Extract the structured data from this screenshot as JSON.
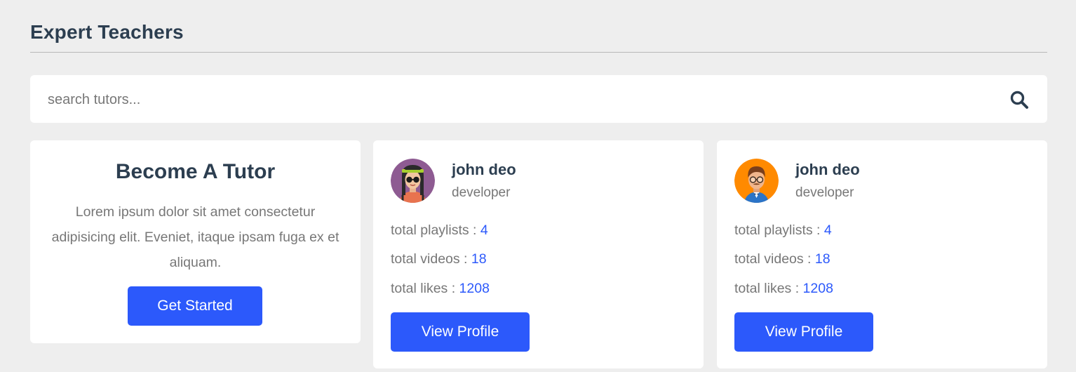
{
  "section": {
    "title": "Expert Teachers"
  },
  "search": {
    "placeholder": "search tutors..."
  },
  "become_card": {
    "title": "Become A Tutor",
    "description": "Lorem ipsum dolor sit amet consectetur adipisicing elit. Eveniet, itaque ipsam fuga ex et aliquam.",
    "button_label": "Get Started"
  },
  "tutors": [
    {
      "name": "john deo",
      "role": "developer",
      "avatar_icon": "female-avatar-icon",
      "avatar_bg": "#8e5b92",
      "playlists_label": "total playlists : ",
      "playlists": "4",
      "videos_label": "total videos : ",
      "videos": "18",
      "likes_label": "total likes : ",
      "likes": "1208",
      "button_label": "View Profile"
    },
    {
      "name": "john deo",
      "role": "developer",
      "avatar_icon": "male-avatar-icon",
      "avatar_bg": "#ff8a00",
      "playlists_label": "total playlists : ",
      "playlists": "4",
      "videos_label": "total videos : ",
      "videos": "18",
      "likes_label": "total likes : ",
      "likes": "1208",
      "button_label": "View Profile"
    }
  ],
  "colors": {
    "accent": "#2c59fb",
    "background": "#eeeeee",
    "heading": "#2c3e50",
    "muted": "#777777"
  }
}
